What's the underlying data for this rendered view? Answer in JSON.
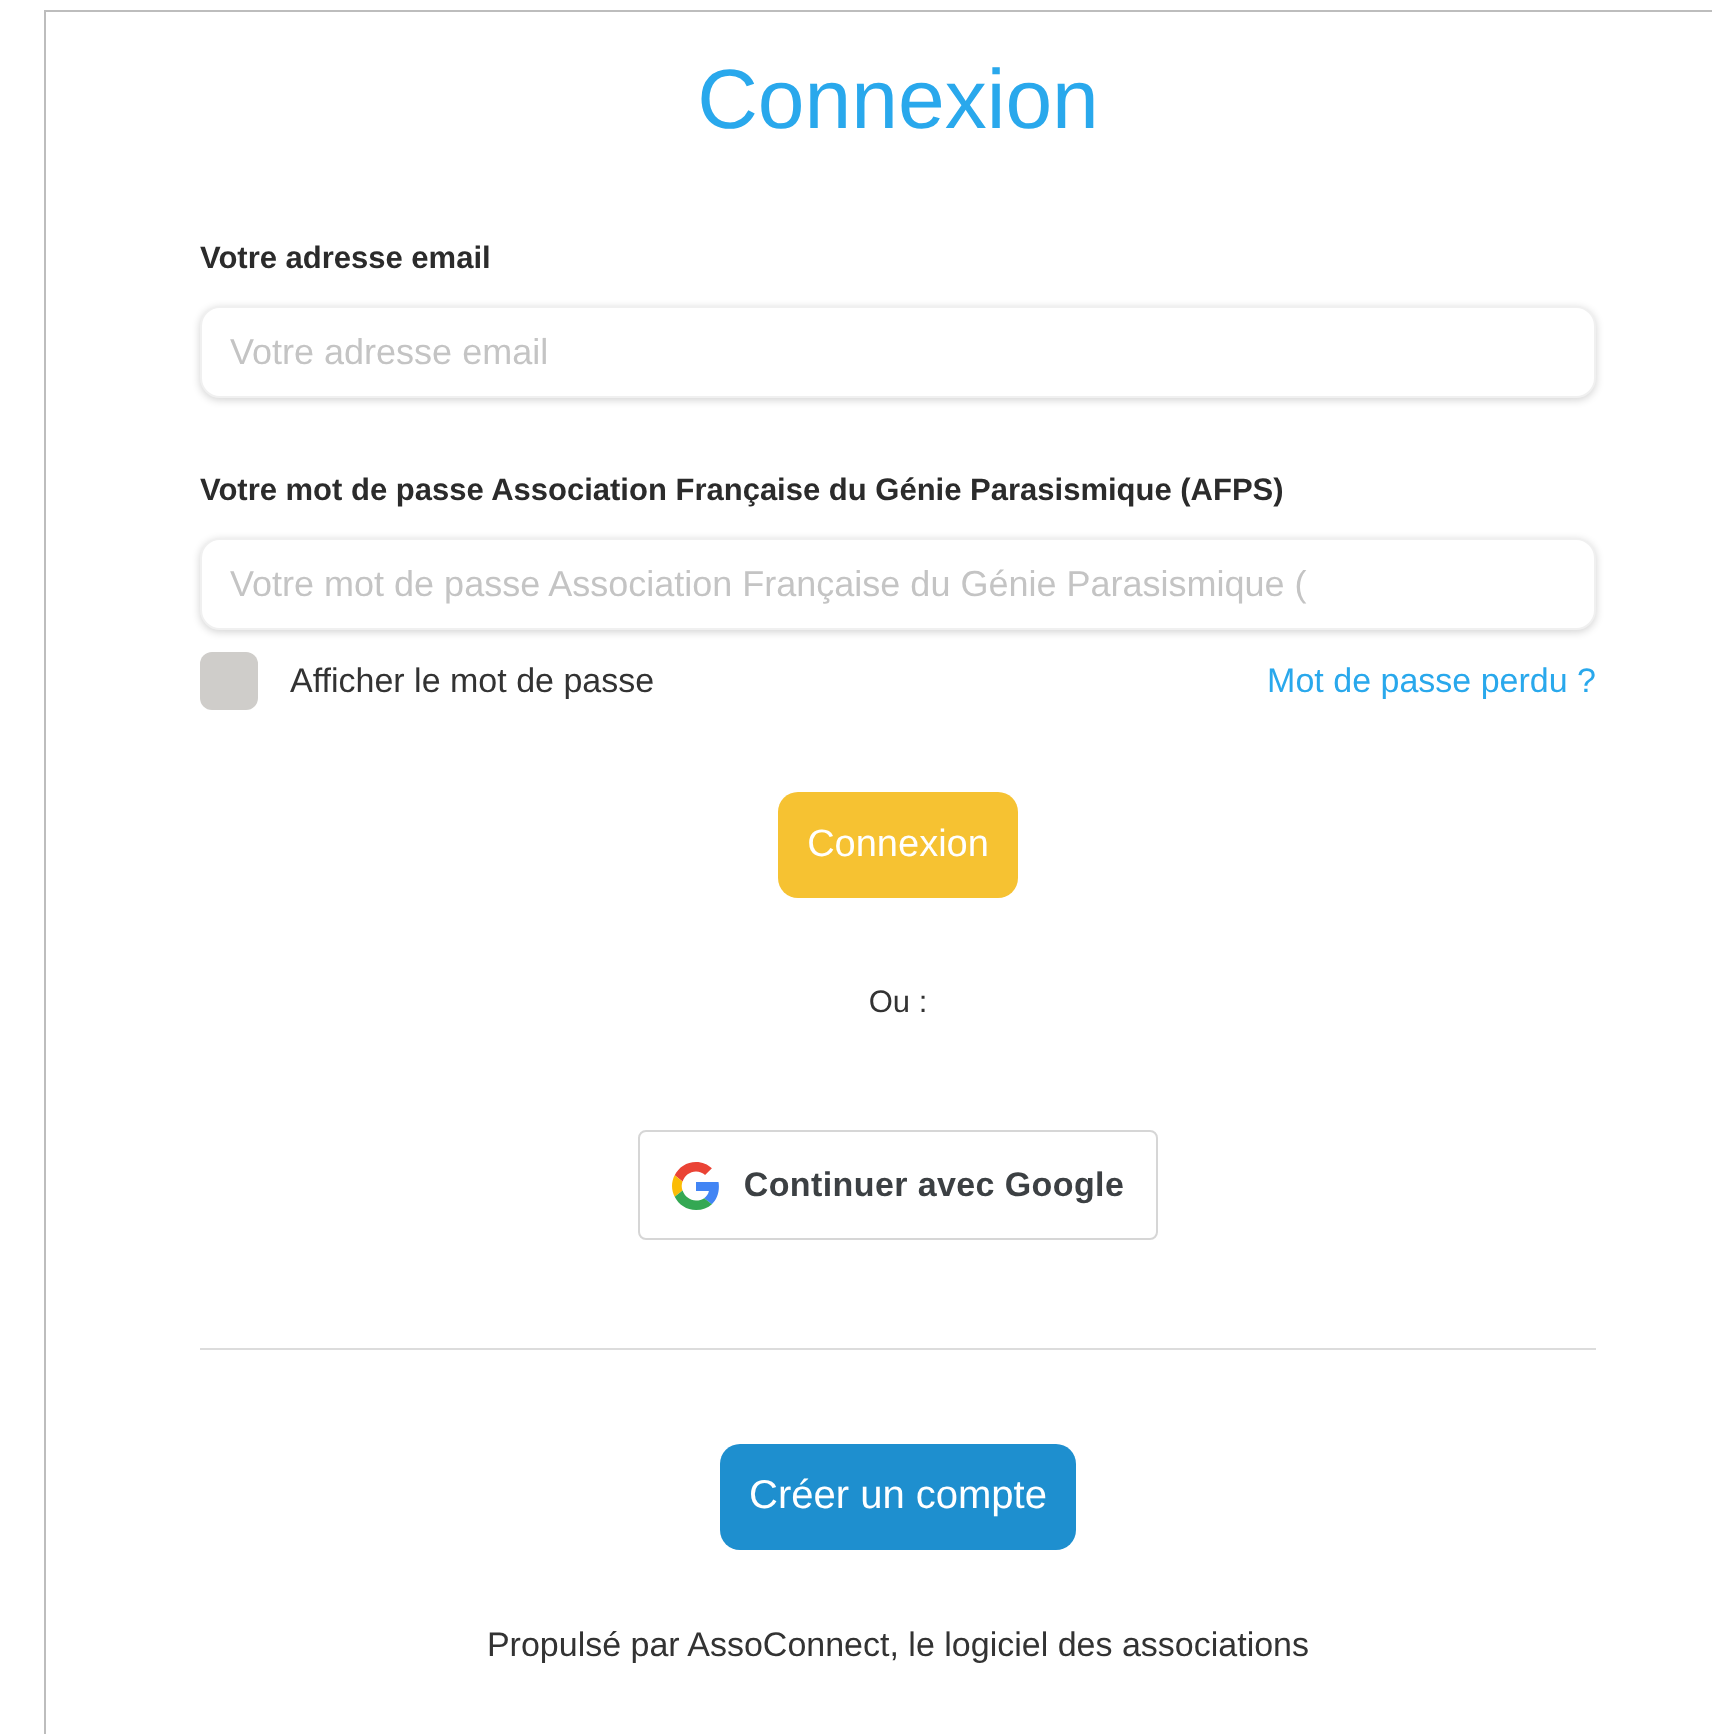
{
  "title": "Connexion",
  "fields": [
    {
      "label": "Votre adresse email",
      "placeholder": "Votre adresse email"
    },
    {
      "label": "Votre mot de passe Association Française du Génie Parasismique (AFPS)",
      "placeholder": "Votre mot de passe Association Française du Génie Parasismique ("
    }
  ],
  "show_password": {
    "label": "Afficher le mot de passe",
    "checked": false
  },
  "forgot_link": "Mot de passe perdu ?",
  "submit_button": "Connexion",
  "separator": "Ou :",
  "google_button": "Continuer avec Google",
  "create_account_button": "Créer un compte",
  "footer": "Propulsé par AssoConnect, le logiciel des associations"
}
